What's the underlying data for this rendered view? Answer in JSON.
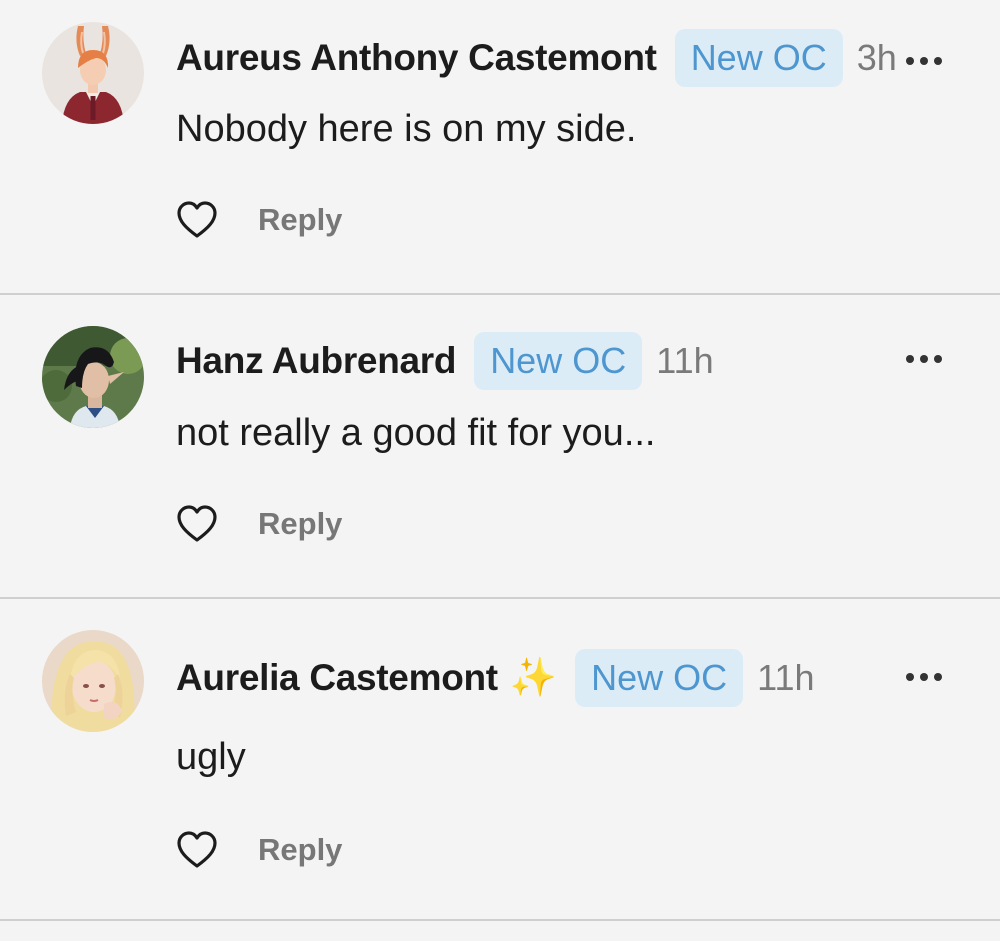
{
  "comments": [
    {
      "author": "Aureus Anthony Castemont",
      "badge": "New OC",
      "time": "3h",
      "text": "Nobody here is on my side.",
      "reply_label": "Reply",
      "like_icon": "heart-outline-icon",
      "more_icon": "more-horizontal-icon"
    },
    {
      "author": "Hanz Aubrenard",
      "badge": "New OC",
      "time": "11h",
      "text": "not really a good fit for you...",
      "reply_label": "Reply",
      "like_icon": "heart-outline-icon",
      "more_icon": "more-horizontal-icon"
    },
    {
      "author": "Aurelia Castemont",
      "author_emoji": "✨",
      "badge": "New OC",
      "time": "11h",
      "text": "ugly",
      "reply_label": "Reply",
      "like_icon": "heart-outline-icon",
      "more_icon": "more-horizontal-icon"
    }
  ],
  "colors": {
    "background": "#f4f4f4",
    "badge_bg": "#dcecf7",
    "badge_text": "#4d96cf",
    "divider": "#cfcfcf",
    "time": "#7a7a7a",
    "reply": "#777777"
  }
}
